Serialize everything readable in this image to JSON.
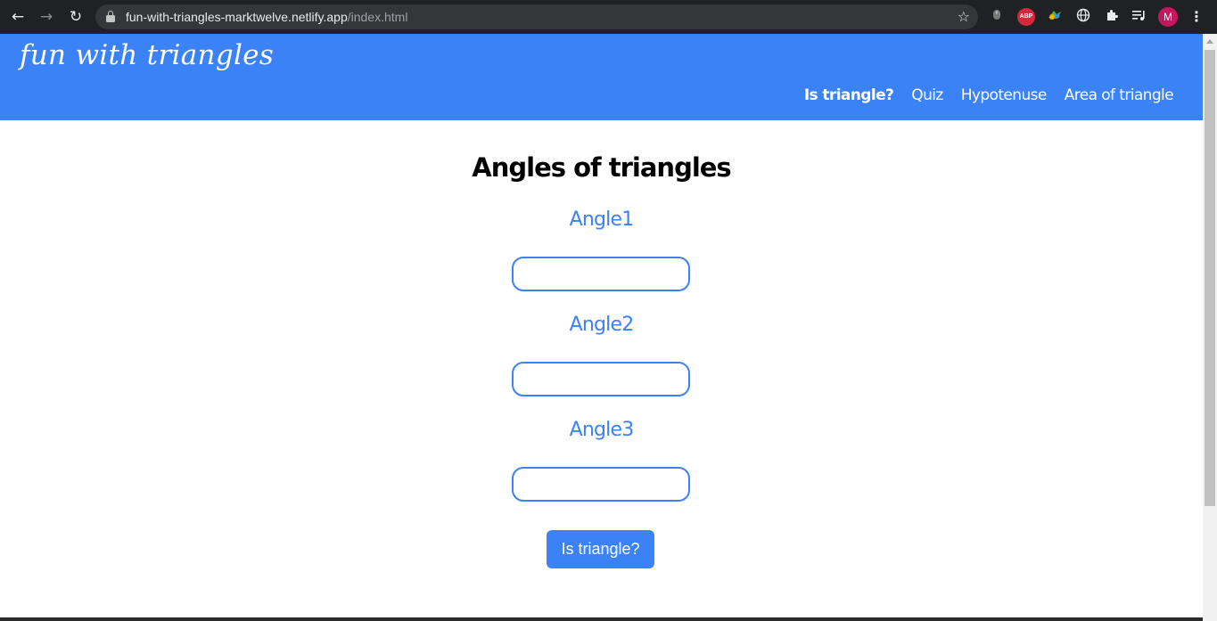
{
  "browser": {
    "url_host": "fun-with-triangles-marktwelve.netlify.app",
    "url_path": "/index.html",
    "profile_initial": "M",
    "extension_abp_label": "ABP"
  },
  "header": {
    "site_title": "fun with triangles",
    "nav": [
      {
        "label": "Is triangle?",
        "active": true
      },
      {
        "label": "Quiz",
        "active": false
      },
      {
        "label": "Hypotenuse",
        "active": false
      },
      {
        "label": "Area of triangle",
        "active": false
      }
    ]
  },
  "form": {
    "title": "Angles of triangles",
    "angles": [
      {
        "label": "Angle1",
        "value": ""
      },
      {
        "label": "Angle2",
        "value": ""
      },
      {
        "label": "Angle3",
        "value": ""
      }
    ],
    "submit_label": "Is triangle?"
  },
  "colors": {
    "brand": "#3b82f6",
    "chrome_bg": "#202124",
    "omnibox_bg": "#35363a",
    "avatar": "#c5175d",
    "abp": "#d6273b"
  }
}
